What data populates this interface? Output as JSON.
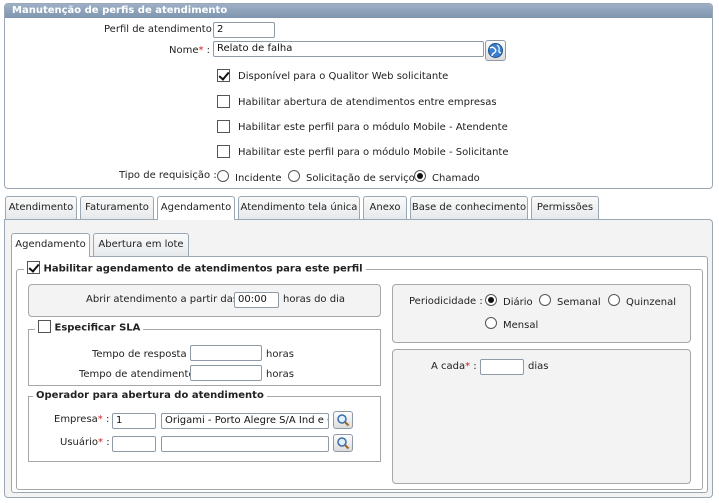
{
  "panel": {
    "title": "Manutenção de perfis de atendimento"
  },
  "form": {
    "perfil_label": "Perfil de atendimento :",
    "perfil_value": "2",
    "nome_label": "Nome",
    "nome_value": "Relato de falha",
    "checkboxes": [
      {
        "label": "Disponível para o Qualitor Web solicitante",
        "checked": true
      },
      {
        "label": "Habilitar abertura de atendimentos entre empresas",
        "checked": false
      },
      {
        "label": "Habilitar este perfil para o módulo Mobile - Atendente",
        "checked": false
      },
      {
        "label": "Habilitar este perfil para o módulo Mobile - Solicitante",
        "checked": false
      }
    ],
    "tipo_label": "Tipo de requisição :",
    "tipo_options": [
      {
        "label": "Incidente",
        "selected": false
      },
      {
        "label": "Solicitação de serviço",
        "selected": false
      },
      {
        "label": "Chamado",
        "selected": true
      }
    ]
  },
  "tabs": [
    "Atendimento",
    "Faturamento",
    "Agendamento",
    "Atendimento tela única",
    "Anexo",
    "Base de conhecimento",
    "Permissões"
  ],
  "active_tab": "Agendamento",
  "subtabs": [
    "Agendamento",
    "Abertura em lote"
  ],
  "active_subtab": "Agendamento",
  "agendamento": {
    "habilitar_label": "Habilitar agendamento de atendimentos para este perfil",
    "habilitar_checked": true,
    "abrir_label": "Abrir atendimento a partir das :",
    "abrir_value": "00:00",
    "abrir_unit": "horas do dia",
    "sla_label": "Especificar SLA",
    "sla_checked": false,
    "resposta_label": "Tempo de resposta :",
    "resposta_unit": "horas",
    "atendimento_label": "Tempo de atendimento :",
    "atendimento_unit": "horas",
    "operador_legend": "Operador para abertura do atendimento",
    "empresa_label": "Empresa",
    "empresa_code": "1",
    "empresa_name": "Origami - Porto Alegre S/A Ind e Co",
    "usuario_label": "Usuário",
    "usuario_code": "",
    "usuario_name": "",
    "periodicidade_label": "Periodicidade :",
    "periodicidade_options": [
      {
        "label": "Diário",
        "selected": true
      },
      {
        "label": "Semanal",
        "selected": false
      },
      {
        "label": "Quinzenal",
        "selected": false
      },
      {
        "label": "Mensal",
        "selected": false
      }
    ],
    "acada_label": "A cada",
    "acada_value": "",
    "acada_unit": "dias"
  },
  "icons": {
    "globe": "globe-icon",
    "search": "magnifier-icon"
  },
  "colors": {
    "header_bg": "#8ea3bc",
    "required": "#cc2222",
    "border": "#9aa7b5"
  }
}
